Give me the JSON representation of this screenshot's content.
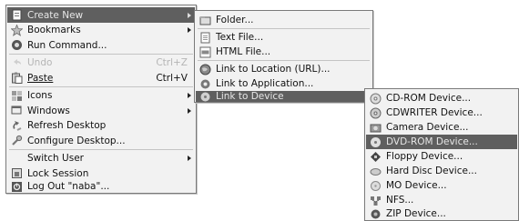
{
  "main_menu": {
    "items": [
      {
        "label": "Create New",
        "icon": "document-icon",
        "selected": true,
        "submenu": true
      },
      {
        "label": "Bookmarks",
        "icon": "star-icon",
        "submenu": true
      },
      {
        "label": "Run Command...",
        "icon": "run-icon"
      },
      {
        "label": "Undo",
        "shortcut": "Ctrl+Z",
        "icon": "undo-icon",
        "disabled": true
      },
      {
        "label": "Paste",
        "shortcut": "Ctrl+V",
        "icon": "paste-icon"
      },
      {
        "label": "Icons",
        "icon": "icons-icon",
        "submenu": true
      },
      {
        "label": "Windows",
        "icon": "windows-icon",
        "submenu": true
      },
      {
        "label": "Refresh Desktop",
        "icon": "refresh-icon"
      },
      {
        "label": "Configure Desktop...",
        "icon": "configure-icon"
      },
      {
        "label": "Switch User",
        "submenu": true
      },
      {
        "label": "Lock Session",
        "icon": "lock-icon"
      },
      {
        "label": "Log Out \"naba\"...",
        "icon": "logout-icon"
      }
    ]
  },
  "create_new_menu": {
    "items": [
      {
        "label": "Folder...",
        "icon": "folder-icon"
      },
      {
        "label": "Text File...",
        "icon": "text-file-icon"
      },
      {
        "label": "HTML File...",
        "icon": "html-file-icon"
      },
      {
        "label": "Link to Location (URL)...",
        "icon": "globe-icon"
      },
      {
        "label": "Link to Application...",
        "icon": "gear-icon"
      },
      {
        "label": "Link to Device",
        "icon": "device-icon",
        "selected": true,
        "submenu": true
      }
    ]
  },
  "device_menu": {
    "items": [
      {
        "label": "CD-ROM Device...",
        "icon": "cdrom-icon"
      },
      {
        "label": "CDWRITER Device...",
        "icon": "cdwriter-icon"
      },
      {
        "label": "Camera Device...",
        "icon": "camera-icon"
      },
      {
        "label": "DVD-ROM Device...",
        "icon": "dvd-icon",
        "selected": true
      },
      {
        "label": "Floppy Device...",
        "icon": "floppy-icon"
      },
      {
        "label": "Hard Disc Device...",
        "icon": "harddisk-icon"
      },
      {
        "label": "MO Device...",
        "icon": "mo-icon"
      },
      {
        "label": "NFS...",
        "icon": "nfs-icon"
      },
      {
        "label": "ZIP Device...",
        "icon": "zip-icon"
      }
    ]
  },
  "colors": {
    "menu_bg": "#f2f2f2",
    "highlight": "#5f5f5f",
    "border": "#7a7a7a",
    "disabled_text": "#b5b5b5"
  }
}
